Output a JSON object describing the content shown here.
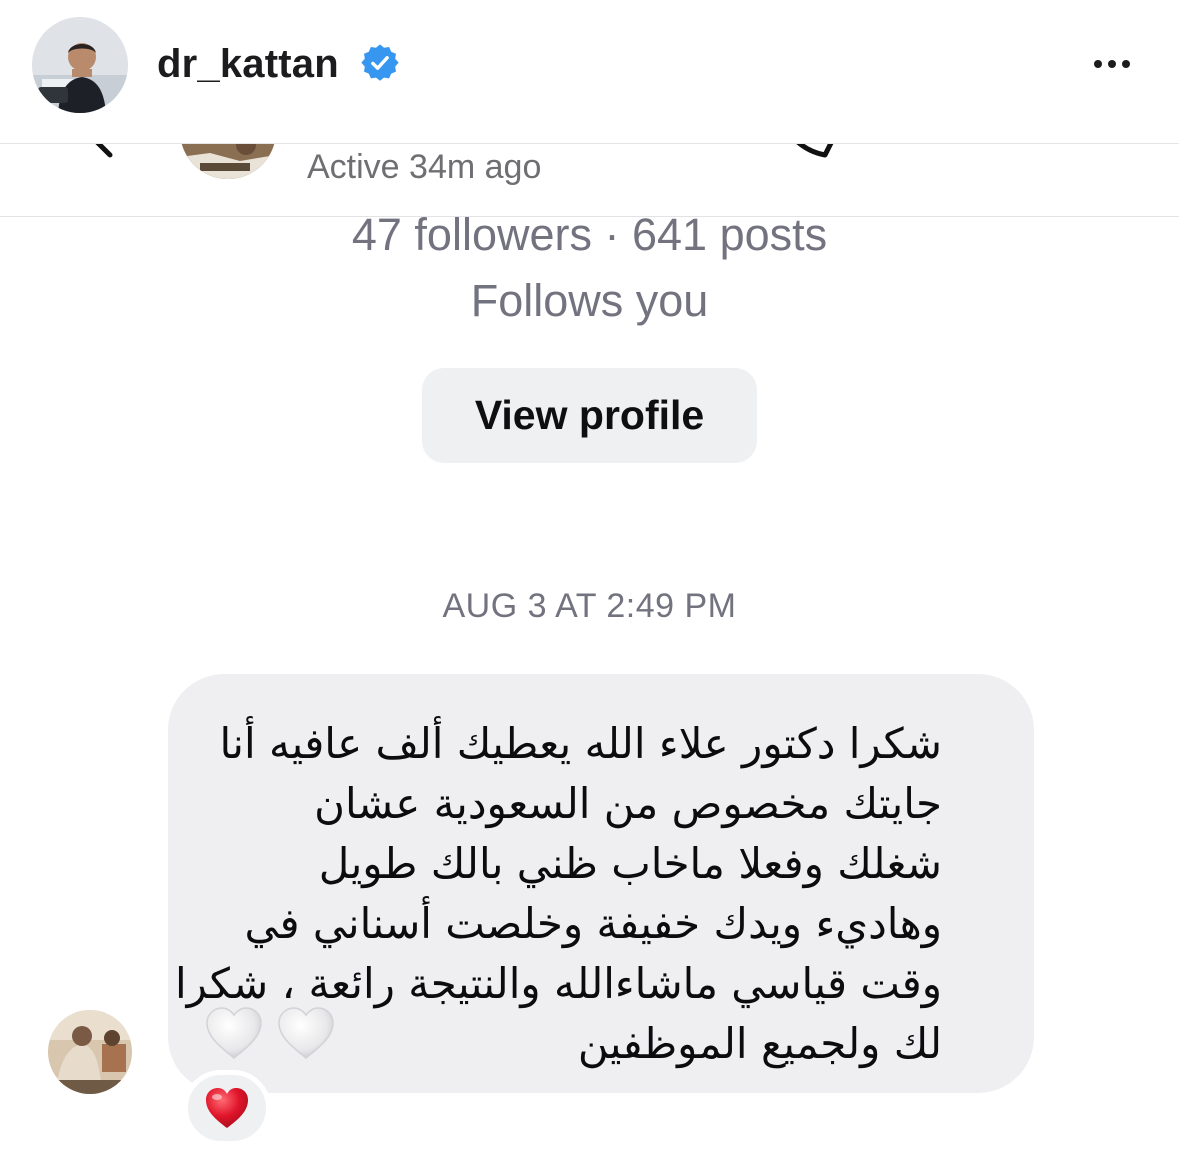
{
  "post_header": {
    "username": "dr_kattan",
    "verified": true,
    "more_icon": "more-horizontal-icon"
  },
  "dm": {
    "active_status": "Active 34m ago",
    "stats": "47 followers · 641 posts",
    "follows_you": "Follows you",
    "view_profile_label": "View profile",
    "timestamp": "AUG 3 AT 2:49 PM",
    "message_text": "شكرا دكتور علاء الله يعطيك ألف عافيه أنا\nجايتك مخصوص من السعودية عشان\nشغلك وفعلا ماخاب ظني بالك طويل\nوهاديء ويدك خفيفة وخلصت أسناني في\nوقت قياسي ماشاءالله والنتيجة رائعة ، شكرا\nلك ولجميع الموظفين",
    "message_emoji": [
      "🤍",
      "🤍"
    ],
    "reaction_emoji": "❤️"
  },
  "colors": {
    "verified_badge": "#3797f0",
    "muted_text": "#737380",
    "bubble_bg": "#efeff2",
    "button_bg": "#eff0f2",
    "heart_red": "#e0142a"
  }
}
